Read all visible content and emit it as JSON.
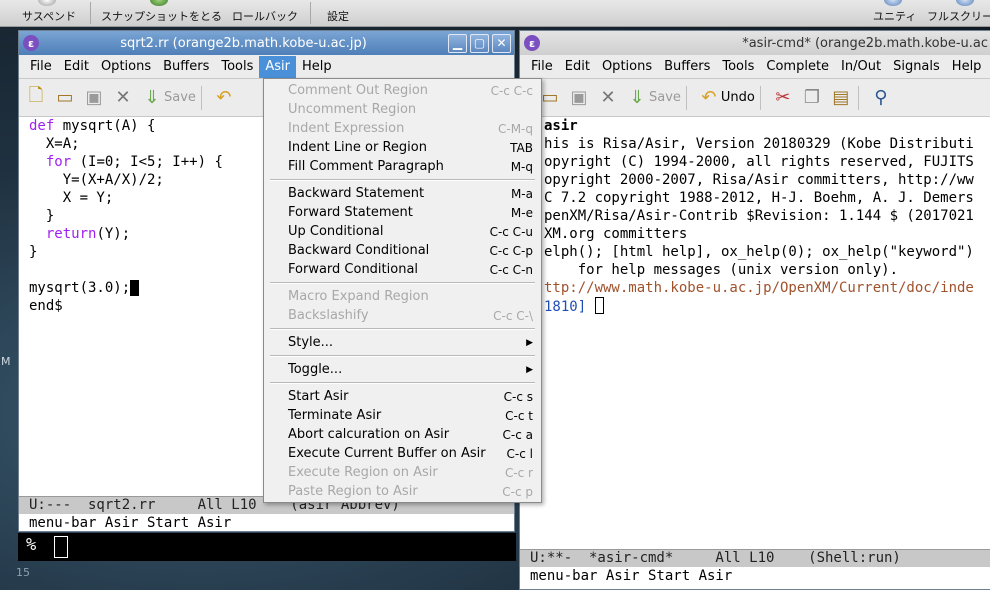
{
  "host": {
    "suspend": "サスペンド",
    "snapshot": "スナップショットをとる",
    "rollback": "ロールバック",
    "settings": "設定",
    "unity": "ユニティ",
    "fullscreen": "フルスクリー"
  },
  "desktop": {
    "side_letter": "M",
    "bottom_number": "15"
  },
  "left_window": {
    "title": "sqrt2.rr (orange2b.math.kobe-u.ac.jp)",
    "minimize_glyph": "▁",
    "maximize_glyph": "▢",
    "close_glyph": "✕",
    "menus": [
      "File",
      "Edit",
      "Options",
      "Buffers",
      "Tools",
      "Asir",
      "Help"
    ],
    "toolbar": {
      "save_label": "Save"
    },
    "code": {
      "l1_kw": "def",
      "l1": " mysqrt(A) {",
      "l2": "  X=A;",
      "l3_kw": "for",
      "l3": " (I=0; I<5; I++) {",
      "l4": "    Y=(X+A/X)/2;",
      "l5": "    X = Y;",
      "l6": "  }",
      "l7_kw": "return",
      "l7": "(Y);",
      "l8": "}",
      "l10": "mysqrt(3.0);",
      "l11": "end$"
    },
    "modeline": "U:---  sqrt2.rr     All L10    (asir Abbrev)",
    "modeline_buffer": "sqrt2.rr",
    "echo": "menu-bar Asir Start Asir"
  },
  "asir_menu": {
    "items": [
      {
        "label": "Comment Out Region",
        "key": "C-c C-c",
        "enabled": false
      },
      {
        "label": "Uncomment Region",
        "key": "",
        "enabled": false
      },
      {
        "label": "Indent Expression",
        "key": "C-M-q",
        "enabled": false
      },
      {
        "label": "Indent Line or Region",
        "key": "TAB",
        "enabled": true
      },
      {
        "label": "Fill Comment Paragraph",
        "key": "M-q",
        "enabled": true
      },
      {
        "label": "Backward Statement",
        "key": "M-a",
        "enabled": true
      },
      {
        "label": "Forward Statement",
        "key": "M-e",
        "enabled": true
      },
      {
        "label": "Up Conditional",
        "key": "C-c C-u",
        "enabled": true
      },
      {
        "label": "Backward Conditional",
        "key": "C-c C-p",
        "enabled": true
      },
      {
        "label": "Forward Conditional",
        "key": "C-c C-n",
        "enabled": true
      },
      {
        "label": "Macro Expand Region",
        "key": "",
        "enabled": false
      },
      {
        "label": "Backslashify",
        "key": "C-c C-\\",
        "enabled": false
      },
      {
        "label": "Style...",
        "key": "",
        "enabled": true
      },
      {
        "label": "Toggle...",
        "key": "",
        "enabled": true
      },
      {
        "label": "Start Asir",
        "key": "C-c s",
        "enabled": true
      },
      {
        "label": "Terminate Asir",
        "key": "C-c t",
        "enabled": true
      },
      {
        "label": "Abort calcuration on Asir",
        "key": "C-c a",
        "enabled": true
      },
      {
        "label": "Execute Current Buffer on Asir",
        "key": "C-c l",
        "enabled": true
      },
      {
        "label": "Execute Region on Asir",
        "key": "C-c r",
        "enabled": false
      },
      {
        "label": "Paste Region to Asir",
        "key": "C-c p",
        "enabled": false
      }
    ]
  },
  "right_window": {
    "title": "*asir-cmd* (orange2b.math.kobe-u.ac",
    "menus": [
      "File",
      "Edit",
      "Options",
      "Buffers",
      "Tools",
      "Complete",
      "In/Out",
      "Signals",
      "Help"
    ],
    "toolbar": {
      "save_label": "Save",
      "undo_label": "Undo"
    },
    "lines": [
      "asir",
      "his is Risa/Asir, Version 20180329 (Kobe Distributi",
      "opyright (C) 1994-2000, all rights reserved, FUJITS",
      "opyright 2000-2007, Risa/Asir committers, http://ww",
      "C 7.2 copyright 1988-2012, H-J. Boehm, A. J. Demers",
      "penXM/Risa/Asir-Contrib $Revision: 1.144 $ (2017021",
      "XM.org committers",
      "elph(); [html help], ox_help(0); ox_help(\"keyword\")",
      "    for help messages (unix version only).",
      "ttp://www.math.kobe-u.ac.jp/OpenXM/Current/doc/inde",
      "1810] "
    ],
    "modeline": "U:**-  *asir-cmd*     All L10    (Shell:run)",
    "echo": "menu-bar Asir Start Asir"
  },
  "terminal": {
    "prompt": "%"
  }
}
